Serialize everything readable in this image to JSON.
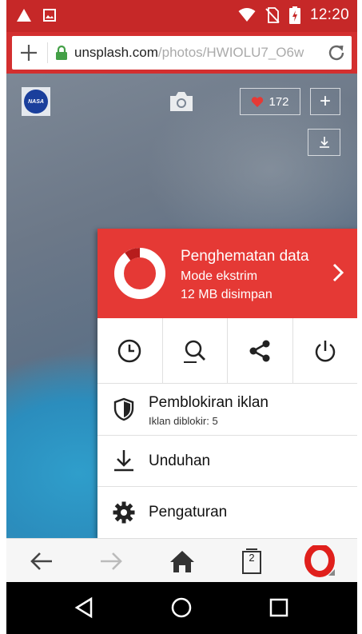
{
  "status_bar": {
    "time": "12:20",
    "icons": [
      "warning-icon",
      "image-icon",
      "wifi-icon",
      "no-sim-icon",
      "battery-charging-icon"
    ]
  },
  "address_bar": {
    "url_host": "unsplash.com",
    "url_path": "/photos/HWIOLU7_O6w"
  },
  "photo_overlay": {
    "likes": "172",
    "add_label": "+"
  },
  "menu": {
    "data_saver": {
      "title": "Penghematan data",
      "mode": "Mode ekstrim",
      "saved": "12 MB disimpan",
      "saved_fraction": 0.1
    },
    "quick_actions": [
      "history-icon",
      "find-in-page-icon",
      "share-icon",
      "power-icon"
    ],
    "items": [
      {
        "label": "Pemblokiran iklan",
        "sub": "Iklan diblokir: 5",
        "icon": "shield-icon"
      },
      {
        "label": "Unduhan",
        "icon": "download-icon"
      },
      {
        "label": "Pengaturan",
        "icon": "settings-icon"
      }
    ]
  },
  "toolbar": {
    "tab_count": "2"
  },
  "colors": {
    "status_bar": "#c62828",
    "address_bar": "#d32f2f",
    "data_saver": "#e53935",
    "opera_red": "#e0201c",
    "nav_bar": "#000000"
  }
}
